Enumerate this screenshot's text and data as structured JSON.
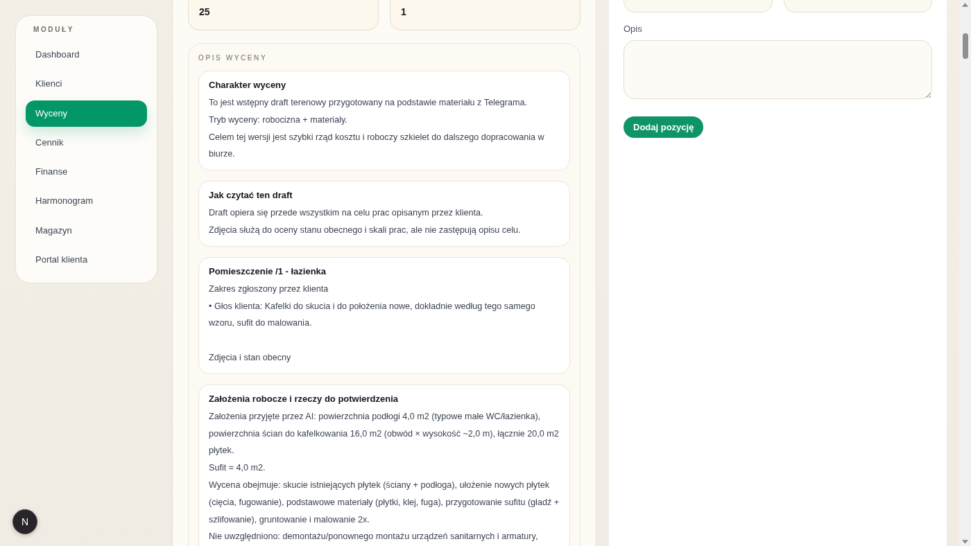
{
  "sidebar": {
    "heading": "MODUŁY",
    "items": [
      {
        "label": "Dashboard",
        "selected": false
      },
      {
        "label": "Klienci",
        "selected": false
      },
      {
        "label": "Wyceny",
        "selected": true
      },
      {
        "label": "Cennik",
        "selected": false
      },
      {
        "label": "Finanse",
        "selected": false
      },
      {
        "label": "Harmonogram",
        "selected": false
      },
      {
        "label": "Magazyn",
        "selected": false
      },
      {
        "label": "Portal klienta",
        "selected": false
      }
    ]
  },
  "dev_badge": {
    "label": "N"
  },
  "quote_fields": [
    {
      "value": "25"
    },
    {
      "value": "1"
    }
  ],
  "quote_description": {
    "heading": "OPIS WYCENY",
    "sections": [
      {
        "title": "Charakter wyceny",
        "groups": [
          [
            "To jest wstępny draft terenowy przygotowany na podstawie materiału z Telegrama.",
            "Tryb wyceny: robocizna + materialy.",
            "Celem tej wersji jest szybki rząd kosztu i roboczy szkielet do dalszego dopracowania w biurze."
          ]
        ]
      },
      {
        "title": "Jak czytać ten draft",
        "groups": [
          [
            "Draft opiera się przede wszystkim na celu prac opisanym przez klienta.",
            "Zdjęcia służą do oceny stanu obecnego i skali prac, ale nie zastępują opisu celu."
          ]
        ]
      },
      {
        "title": "Pomieszczenie /1 - łazienka",
        "groups": [
          [
            "Zakres zgłoszony przez klienta",
            "• Głos klienta: Kafelki do skucia i do położenia nowe, dokładnie według tego samego wzoru, sufit do malowania."
          ],
          [
            "Zdjęcia i stan obecny"
          ]
        ]
      },
      {
        "title": "Założenia robocze i rzeczy do potwierdzenia",
        "groups": [
          [
            "Założenia przyjęte przez AI: powierzchnia podłogi 4,0 m2 (typowe małe WC/łazienka), powierzchnia ścian do kafelkowania 16,0 m2 (obwód × wysokość ~2,0 m), łącznie 20,0 m2 płytek.",
            "Sufit = 4,0 m2.",
            "Wycena obejmuje: skucie istniejących płytek (ściany + podłoga), ułożenie nowych płytek (cięcia, fugowanie), podstawowe materiały (płytki, klej, fuga), przygotowanie sufitu (gładź + szlifowanie), gruntowanie i malowanie 2x.",
            "Nie uwzględniono: demontażu/ponownego montażu urządzeń sanitarnych i armatury,"
          ]
        ]
      }
    ]
  },
  "item_form": {
    "description_label": "Opis",
    "submit_button": "Dodaj pozycję"
  }
}
